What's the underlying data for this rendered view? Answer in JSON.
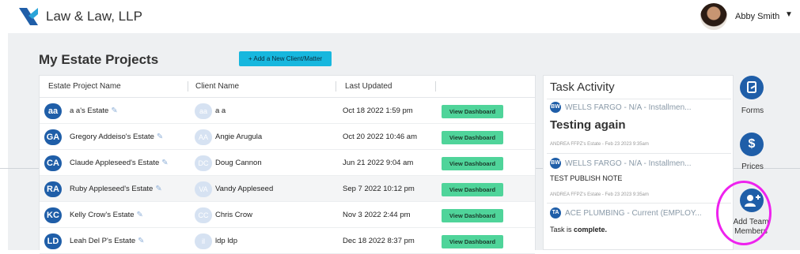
{
  "app": {
    "brand": "Law & Law, LLP"
  },
  "user": {
    "name": "Abby Smith",
    "caret": "▼"
  },
  "page": {
    "title": "My Estate Projects",
    "add_button": "+ Add a New Client/Matter"
  },
  "table": {
    "headers": [
      "Estate Project Name",
      "Client Name",
      "Last Updated"
    ],
    "button_label": "View Dashboard",
    "rows": [
      {
        "initials": "aa",
        "estate": "a a's Estate",
        "client_initials": "aa",
        "client": "a a",
        "updated": "Oct 18 2022 1:59 pm"
      },
      {
        "initials": "GA",
        "estate": "Gregory Addeiso's Estate",
        "client_initials": "AA",
        "client": "Angie Arugula",
        "updated": "Oct 20 2022 10:46 am"
      },
      {
        "initials": "CA",
        "estate": "Claude Appleseed's Estate",
        "client_initials": "DC",
        "client": "Doug Cannon",
        "updated": "Jun 21 2022 9:04 am"
      },
      {
        "initials": "RA",
        "estate": "Ruby Appleseed's Estate",
        "client_initials": "VA",
        "client": "Vandy Appleseed",
        "updated": "Sep 7 2022 10:12 pm"
      },
      {
        "initials": "KC",
        "estate": "Kelly Crow's Estate",
        "client_initials": "CC",
        "client": "Chris Crow",
        "updated": "Nov 3 2022 2:44 pm"
      },
      {
        "initials": "LD",
        "estate": "Leah Del P's Estate",
        "client_initials": "il",
        "client": "ldp ldp",
        "updated": "Dec 18 2022 8:37 pm"
      }
    ]
  },
  "activity": {
    "title": "Task Activity",
    "items": [
      {
        "badge": "BW",
        "header": "WELLS FARGO - N/A - Installmen...",
        "body": "Testing again",
        "meta": "ANDREA FFPZ's Estate - Feb 23 2023 9:35am"
      },
      {
        "badge": "BW",
        "header": "WELLS FARGO - N/A - Installmen...",
        "body": "TEST PUBLISH NOTE",
        "meta": "ANDREA FFPZ's Estate - Feb 23 2023 9:35am"
      },
      {
        "badge": "TA",
        "header": "ACE PLUMBING - Current (EMPLOY...",
        "body_prefix": "Task is ",
        "body_strong": "complete."
      }
    ]
  },
  "tools": [
    {
      "icon": "forms-icon",
      "label": "Forms"
    },
    {
      "icon": "dollar-icon",
      "label": "Prices"
    },
    {
      "icon": "add-user-icon",
      "label": "Add Team Members"
    }
  ],
  "colors": {
    "brand_blue": "#1f5ea8",
    "add_button": "#17b7de",
    "view_button": "#4fd49a",
    "highlight": "#ee22ee"
  }
}
